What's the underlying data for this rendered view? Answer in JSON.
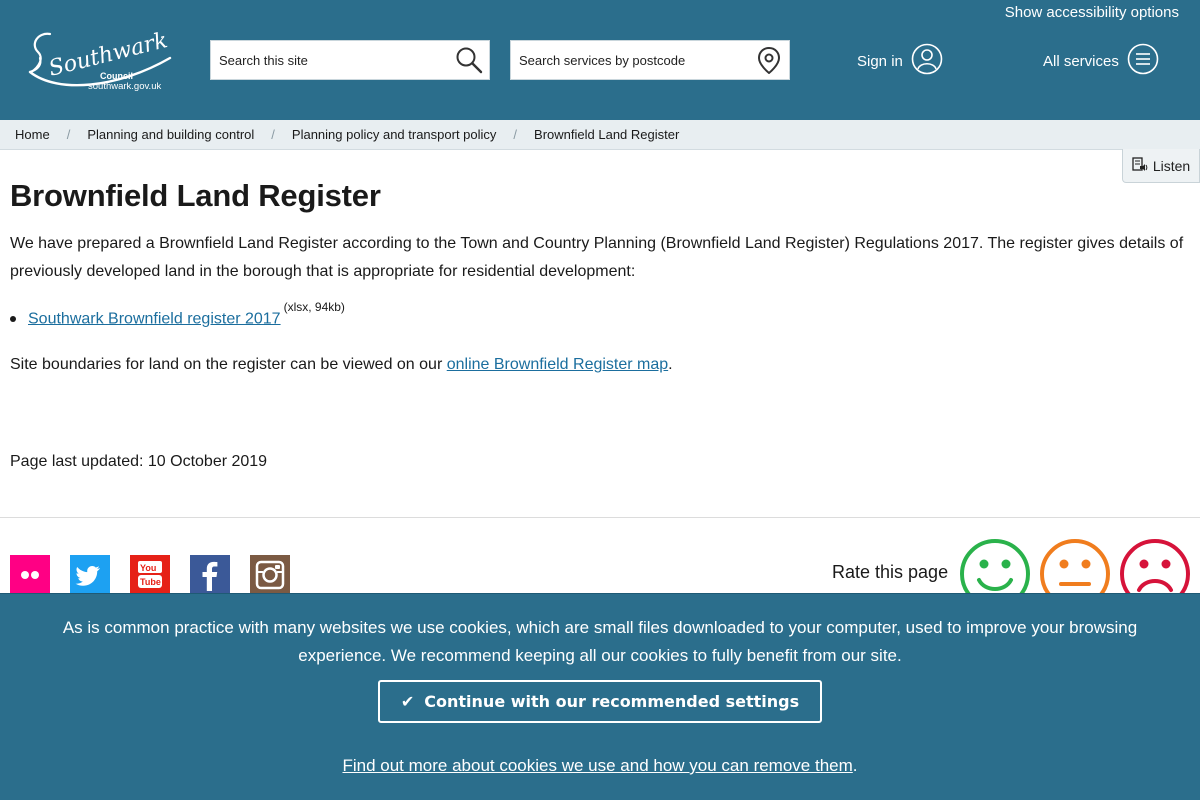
{
  "header": {
    "accessibility_link": "Show accessibility options",
    "logo": {
      "name": "Southwark",
      "council": "Council",
      "url": "southwark.gov.uk",
      "icon": "southwark-council-logo"
    },
    "site_search": {
      "placeholder": "Search this site",
      "icon": "search-icon"
    },
    "postcode_search": {
      "placeholder": "Search services by postcode",
      "icon": "location-pin-icon"
    },
    "sign_in": {
      "label": "Sign in",
      "icon": "user-icon"
    },
    "all_services": {
      "label": "All services",
      "icon": "menu-icon"
    },
    "colors": {
      "brand": "#2b6e8c"
    }
  },
  "breadcrumb": {
    "items": [
      "Home",
      "Planning and building control",
      "Planning policy and transport policy"
    ],
    "current": "Brownfield Land Register",
    "separator": "/"
  },
  "listen": {
    "label": "Listen",
    "icon": "speaker-icon"
  },
  "main": {
    "title": "Brownfield Land Register",
    "intro": "We have prepared a Brownfield Land Register according to the Town and Country Planning (Brownfield Land Register) Regulations 2017. The register gives details of previously developed land in the borough that is appropriate for residential development:",
    "documents": [
      {
        "label": "Southwark Brownfield register 2017",
        "meta": "(xlsx, 94kb)"
      }
    ],
    "map_text_before": "Site boundaries for land on the register can be viewed on our ",
    "map_link": "online Brownfield Register map",
    "map_text_after": ".",
    "last_updated": "Page last updated: 10 October 2019",
    "link_color": "#1b6e9e"
  },
  "footer": {
    "social": [
      {
        "name": "flickr",
        "icon": "flickr-icon",
        "color": "#ff0084"
      },
      {
        "name": "twitter",
        "icon": "twitter-icon",
        "color": "#1da1f2"
      },
      {
        "name": "youtube",
        "icon": "youtube-icon",
        "color": "#e62117"
      },
      {
        "name": "facebook",
        "icon": "facebook-icon",
        "color": "#3b5998"
      },
      {
        "name": "instagram",
        "icon": "instagram-icon",
        "color": "#7b5a43"
      }
    ],
    "rate_label": "Rate this page",
    "ratings": [
      {
        "icon": "happy-face-icon",
        "color": "#2ab24b"
      },
      {
        "icon": "neutral-face-icon",
        "color": "#f07d1e"
      },
      {
        "icon": "sad-face-icon",
        "color": "#d6133a"
      }
    ]
  },
  "cookie_banner": {
    "text": "As is common practice with many websites we use cookies, which are small files downloaded to your computer, used to improve your browsing experience. We recommend keeping all our cookies to fully benefit from our site.",
    "button_label": "Continue with our recommended settings",
    "button_icon": "check-icon",
    "more_link": "Find out more about cookies we use and how you can remove them",
    "more_suffix": "."
  }
}
